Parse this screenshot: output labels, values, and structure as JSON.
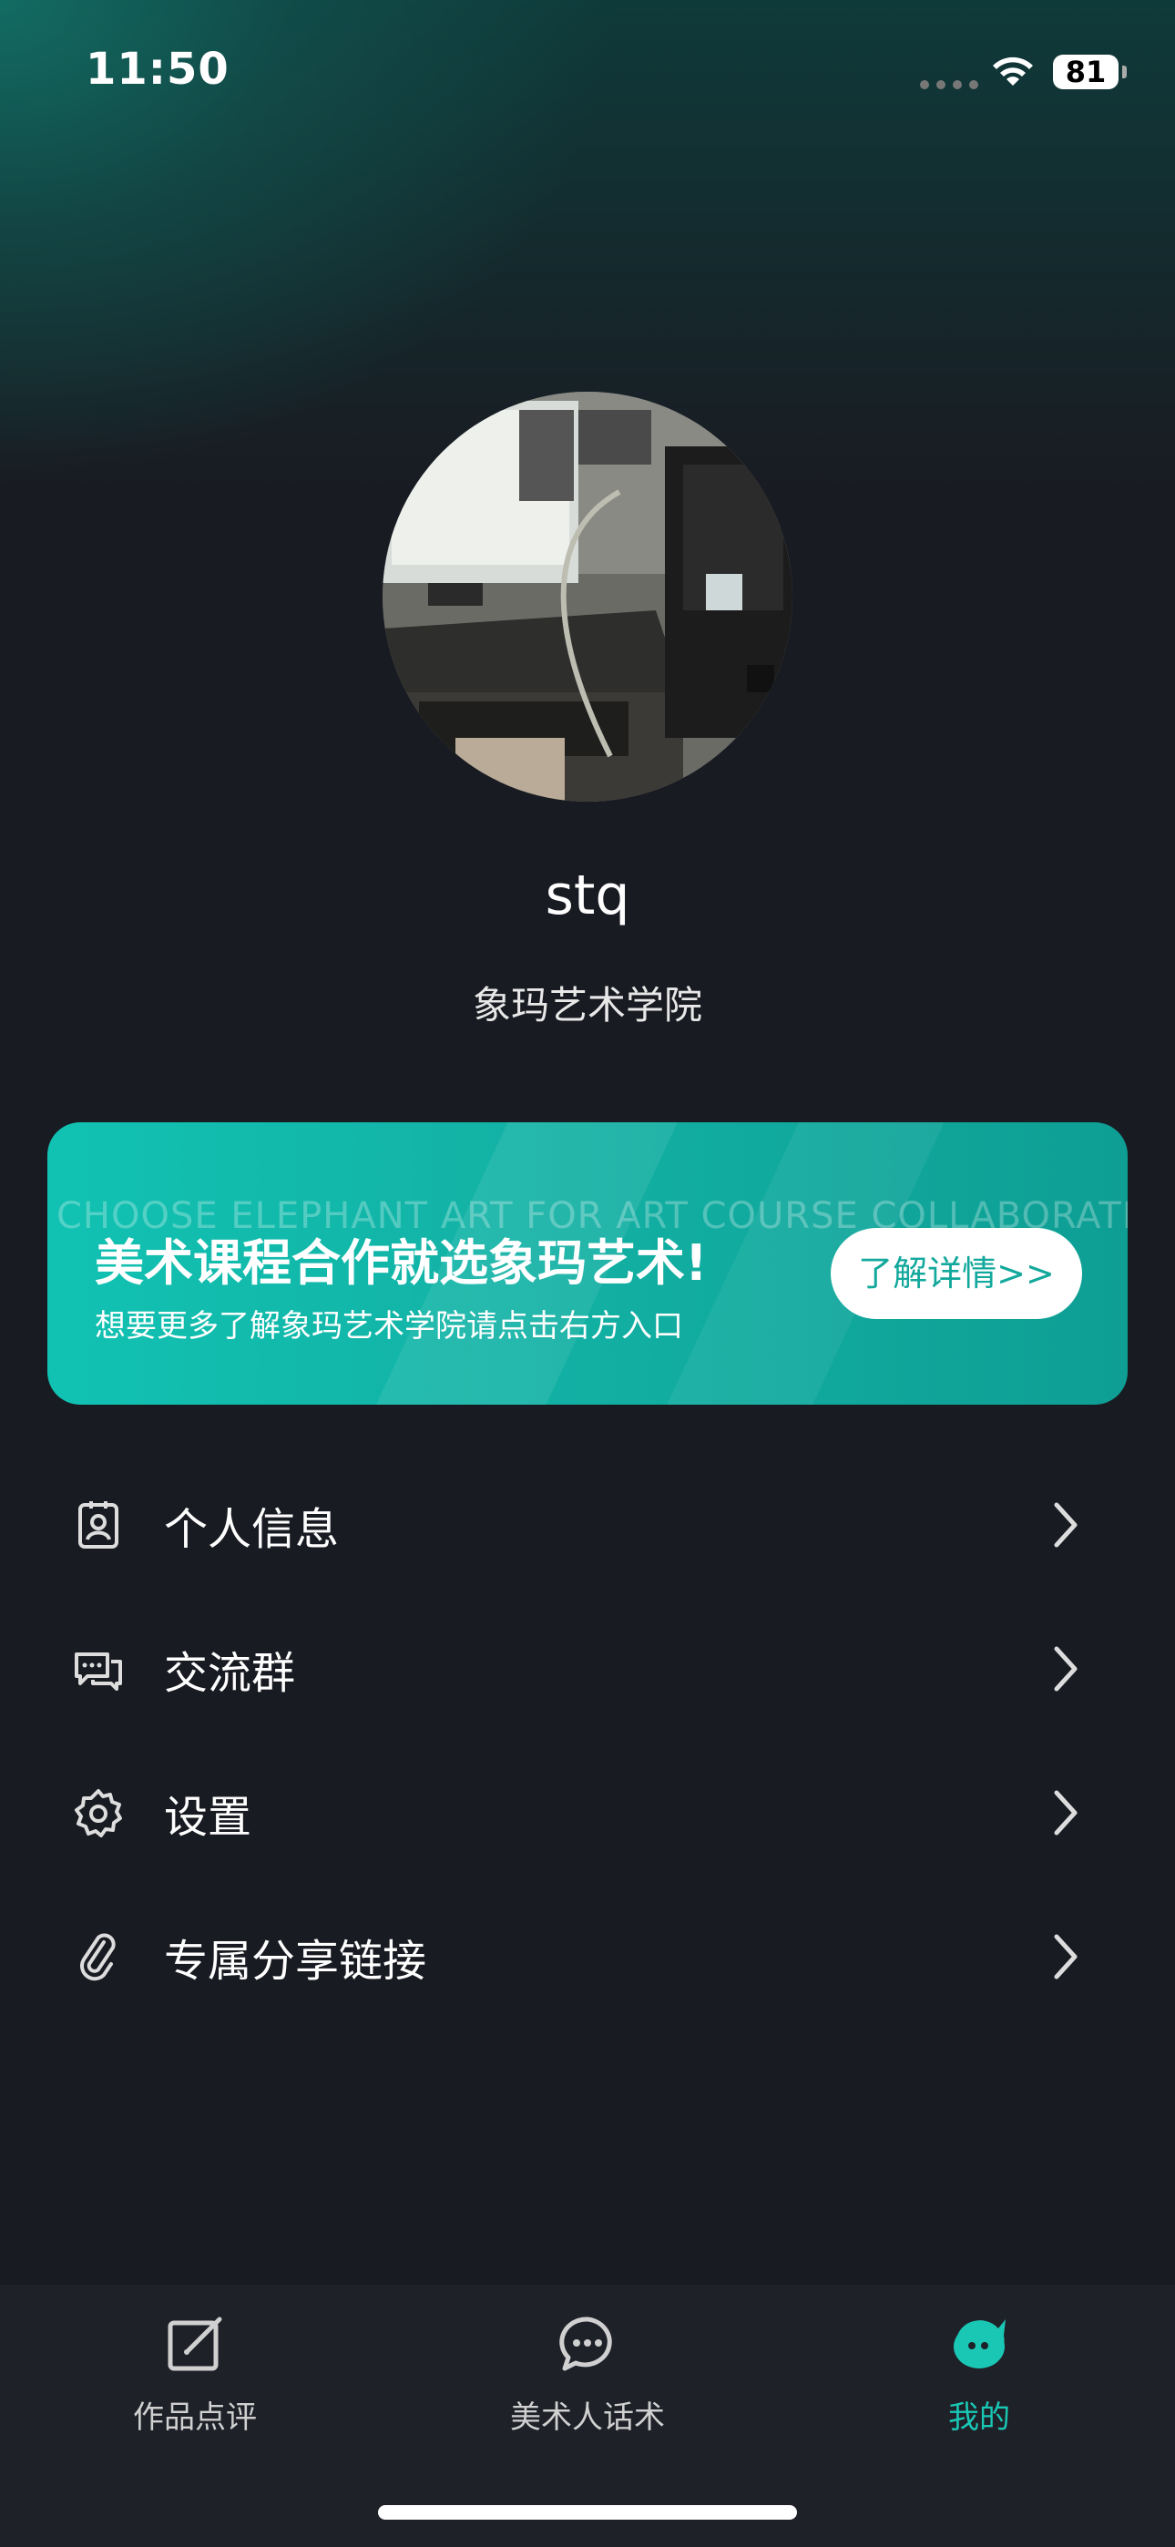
{
  "status": {
    "time": "11:50",
    "battery": "81"
  },
  "profile": {
    "username": "stq",
    "school": "象玛艺术学院"
  },
  "banner": {
    "watermark": "CHOOSE ELEPHANT ART FOR ART COURSE COLLABORATION!",
    "title": "美术课程合作就选象玛艺术!",
    "subtitle": "想要更多了解象玛艺术学院请点击右方入口",
    "button": "了解详情>>",
    "colors": {
      "start": "#11c2b2",
      "end": "#0e9e94"
    }
  },
  "menu": [
    {
      "label": "个人信息",
      "icon": "id-badge-icon"
    },
    {
      "label": "交流群",
      "icon": "chat-group-icon"
    },
    {
      "label": "设置",
      "icon": "gear-icon"
    },
    {
      "label": "专属分享链接",
      "icon": "link-icon"
    }
  ],
  "tabs": [
    {
      "label": "作品点评",
      "icon": "edit-icon",
      "active": false
    },
    {
      "label": "美术人话术",
      "icon": "chat-bubble-icon",
      "active": false
    },
    {
      "label": "我的",
      "icon": "mascot-icon",
      "active": true
    }
  ],
  "colors": {
    "background": "#191b22",
    "accent": "#19c7b4",
    "tab_bar": "#1f2129"
  }
}
